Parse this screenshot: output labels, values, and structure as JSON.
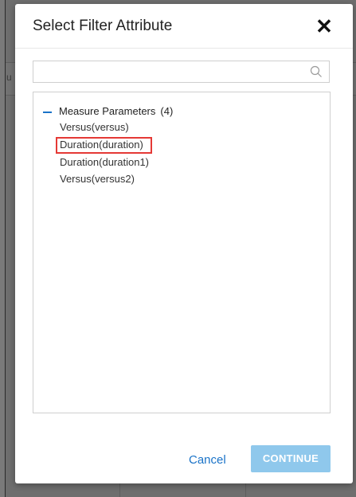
{
  "dialog": {
    "title": "Select Filter Attribute",
    "close_label": "✕"
  },
  "search": {
    "value": "",
    "placeholder": ""
  },
  "tree": {
    "group": {
      "label": "Measure Parameters",
      "count": "(4)",
      "expanded": true
    },
    "items": [
      {
        "label": "Versus(versus)"
      },
      {
        "label": "Duration(duration)",
        "highlighted": true
      },
      {
        "label": "Duration(duration1)"
      },
      {
        "label": "Versus(versus2)"
      }
    ]
  },
  "footer": {
    "cancel_label": "Cancel",
    "continue_label": "CONTINUE"
  },
  "background": {
    "partial_text": "u"
  },
  "colors": {
    "accent": "#1a73c8",
    "continue_bg": "#8fc8ec",
    "highlight": "#e53935",
    "overlay": "#6e6e6e"
  }
}
